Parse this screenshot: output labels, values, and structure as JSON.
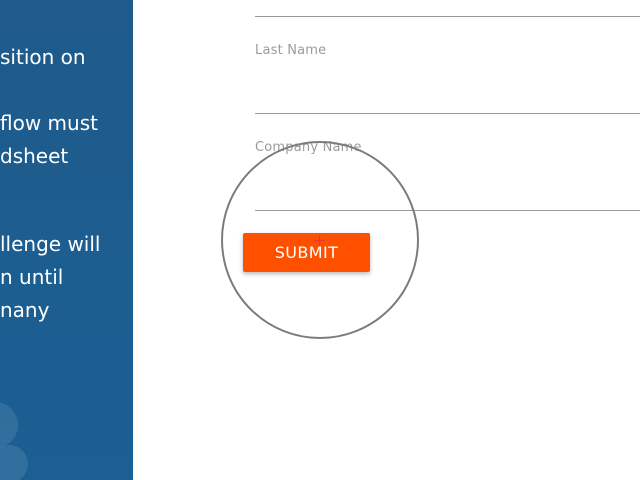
{
  "sidebar": {
    "lines": [
      "sition on",
      "flow must",
      "dsheet",
      "llenge will",
      "n until",
      "nany"
    ]
  },
  "form": {
    "last_name_label": "Last Name",
    "company_name_label": "Company Name",
    "submit_label": "SUBMIT"
  },
  "colors": {
    "sidebar_background": "#1d5d8f",
    "submit_background": "#ff5000",
    "submit_text": "#ffffff",
    "field_label": "#9b9b9b",
    "field_underline": "#9a9a9a",
    "cursor_marker": "#e53935"
  },
  "icons": {
    "click_indicator": "click-ring-icon",
    "cursor": "crosshair-cursor-icon"
  }
}
